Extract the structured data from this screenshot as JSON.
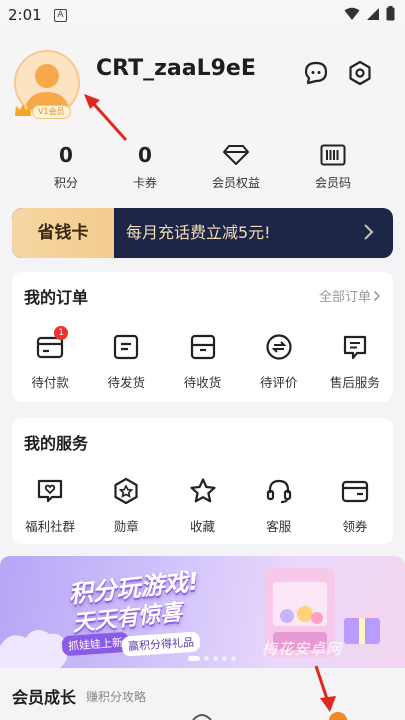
{
  "status_bar": {
    "time": "2:01",
    "notification_letter": "A"
  },
  "profile": {
    "username": "CRT_zaaL9eE",
    "vip_label": "V1会员",
    "icons": [
      "chat-icon",
      "settings-hexagon-icon"
    ]
  },
  "stats": [
    {
      "value": "0",
      "label": "积分"
    },
    {
      "value": "0",
      "label": "卡券"
    },
    {
      "icon": "diamond-icon",
      "label": "会员权益"
    },
    {
      "icon": "barcode-icon",
      "label": "会员码"
    }
  ],
  "saving_card": {
    "tag": "省钱卡",
    "text": "每月充话费立减5元!"
  },
  "orders": {
    "title": "我的订单",
    "all_link": "全部订单",
    "items": [
      {
        "label": "待付款",
        "icon": "wallet-card-icon",
        "badge": "1"
      },
      {
        "label": "待发货",
        "icon": "package-icon"
      },
      {
        "label": "待收货",
        "icon": "inbox-icon"
      },
      {
        "label": "待评价",
        "icon": "review-icon"
      },
      {
        "label": "售后服务",
        "icon": "after-sales-icon"
      }
    ]
  },
  "services": {
    "title": "我的服务",
    "items": [
      {
        "label": "福利社群",
        "icon": "community-icon"
      },
      {
        "label": "勋章",
        "icon": "medal-icon"
      },
      {
        "label": "收藏",
        "icon": "star-icon"
      },
      {
        "label": "客服",
        "icon": "headset-icon"
      },
      {
        "label": "领券",
        "icon": "coupon-icon"
      }
    ]
  },
  "banner": {
    "title": "积分玩游戏!",
    "subtitle": "天天有惊喜",
    "chip_left": "抓娃娃上新",
    "chip_right": "赢积分得礼品",
    "watermark": "梅花安卓网"
  },
  "growth": {
    "title": "会员成长",
    "subtitle": "赚积分攻略"
  },
  "colors": {
    "accent_orange": "#f08a24",
    "card_navy": "#1d2547",
    "gold": "#f2cb8f",
    "badge_red": "#f23030",
    "annotation_red": "#e0281e"
  }
}
